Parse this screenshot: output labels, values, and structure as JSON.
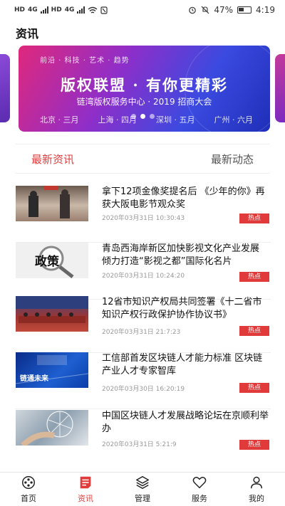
{
  "status": {
    "left_labels": [
      "HD",
      "4G",
      "HD",
      "4G"
    ],
    "battery": "47%",
    "time": "4:19"
  },
  "page_title": "资讯",
  "banner": {
    "tags": "前沿 · 科技 · 艺术 · 趋势",
    "headline": "版权联盟 · 有你更精彩",
    "subtitle": "链湾版权服务中心 · 2019 招商大会",
    "cities": [
      "北京 · 三月",
      "上海 · 四月",
      "深圳 · 五月",
      "广州 · 六月"
    ],
    "active_dot": 1
  },
  "tabs": {
    "latest_news": "最新资讯",
    "latest_activity": "最新动态"
  },
  "news": [
    {
      "title": "拿下12项金像奖提名后 《少年的你》再获大阪电影节观众奖",
      "time": "2020年03月31日 10:30:43",
      "badge": "热点",
      "thumb_text": ""
    },
    {
      "title": "青岛西海岸新区加快影视文化产业发展 倾力打造“影视之都”国际化名片",
      "time": "2020年03月31日 10:24:20",
      "badge": "热点",
      "thumb_text": "政策"
    },
    {
      "title": "12省市知识产权局共同签署《十二省市知识产权行政保护协作协议书》",
      "time": "2020年03月31日 21:7:23",
      "badge": "热点",
      "thumb_text": ""
    },
    {
      "title": "工信部首发区块链人才能力标准 区块链产业人才专家智库",
      "time": "2020年03月30日 16:20:19",
      "badge": "热点",
      "thumb_text": "链通未来"
    },
    {
      "title": "中国区块链人才发展战略论坛在京顺利举办",
      "time": "2020年03月31日 5:21:9",
      "badge": "热点",
      "thumb_text": ""
    }
  ],
  "nav": [
    {
      "label": "首页",
      "icon": "home-icon"
    },
    {
      "label": "资讯",
      "icon": "news-icon",
      "active": true
    },
    {
      "label": "管理",
      "icon": "layers-icon"
    },
    {
      "label": "服务",
      "icon": "heart-icon"
    },
    {
      "label": "我的",
      "icon": "user-icon"
    }
  ],
  "colors": {
    "accent": "#e23b3b",
    "badge": "#e03a3a"
  }
}
